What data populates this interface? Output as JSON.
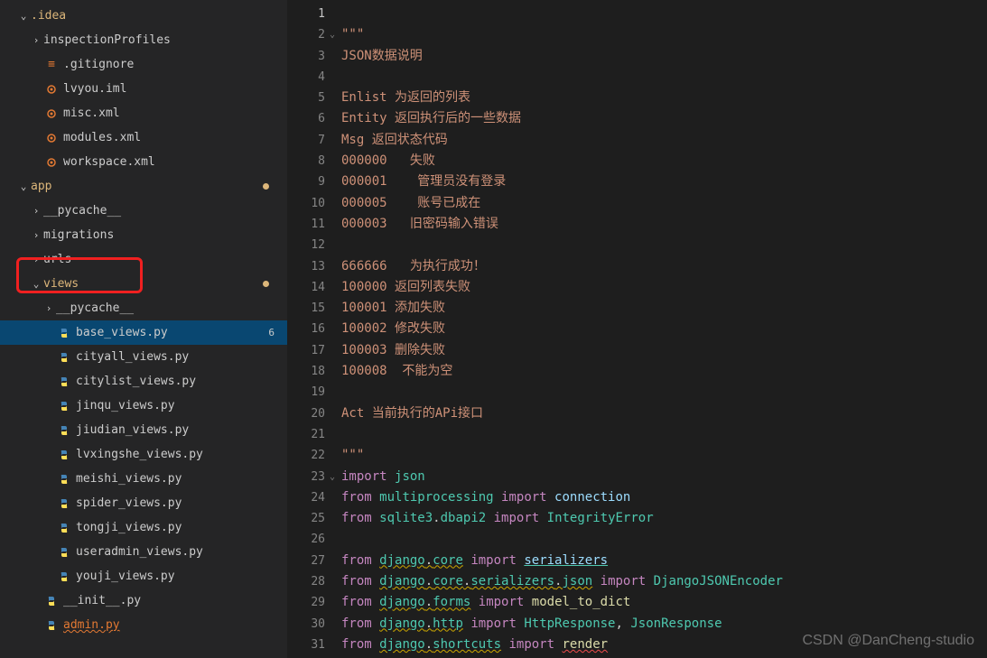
{
  "sidebar": {
    "items": [
      {
        "depth": 0,
        "chev": "v",
        "icon": "",
        "label": ".idea",
        "cls": "orange",
        "dot": false
      },
      {
        "depth": 1,
        "chev": ">",
        "icon": "",
        "label": "inspectionProfiles",
        "cls": "white",
        "dot": false
      },
      {
        "depth": 1,
        "chev": "",
        "icon": "git",
        "label": ".gitignore",
        "cls": "white",
        "dot": false
      },
      {
        "depth": 1,
        "chev": "",
        "icon": "iml",
        "label": "lvyou.iml",
        "cls": "white",
        "dot": false
      },
      {
        "depth": 1,
        "chev": "",
        "icon": "xml",
        "label": "misc.xml",
        "cls": "white",
        "dot": false
      },
      {
        "depth": 1,
        "chev": "",
        "icon": "xml",
        "label": "modules.xml",
        "cls": "white",
        "dot": false
      },
      {
        "depth": 1,
        "chev": "",
        "icon": "xml",
        "label": "workspace.xml",
        "cls": "white",
        "dot": false
      },
      {
        "depth": 0,
        "chev": "v",
        "icon": "",
        "label": "app",
        "cls": "orange",
        "dot": true
      },
      {
        "depth": 1,
        "chev": ">",
        "icon": "",
        "label": "__pycache__",
        "cls": "white",
        "dot": false
      },
      {
        "depth": 1,
        "chev": ">",
        "icon": "",
        "label": "migrations",
        "cls": "white",
        "dot": false
      },
      {
        "depth": 1,
        "chev": ">",
        "icon": "",
        "label": "urls",
        "cls": "white",
        "dot": false
      },
      {
        "depth": 1,
        "chev": "v",
        "icon": "",
        "label": "views",
        "cls": "orange",
        "dot": true,
        "hl": true
      },
      {
        "depth": 2,
        "chev": ">",
        "icon": "",
        "label": "__pycache__",
        "cls": "white",
        "dot": false
      },
      {
        "depth": 2,
        "chev": "",
        "icon": "py",
        "label": "base_views.py",
        "cls": "white",
        "active": true,
        "badge": "6"
      },
      {
        "depth": 2,
        "chev": "",
        "icon": "py",
        "label": "cityall_views.py",
        "cls": "white",
        "dot": false
      },
      {
        "depth": 2,
        "chev": "",
        "icon": "py",
        "label": "citylist_views.py",
        "cls": "white",
        "dot": false
      },
      {
        "depth": 2,
        "chev": "",
        "icon": "py",
        "label": "jinqu_views.py",
        "cls": "white",
        "dot": false
      },
      {
        "depth": 2,
        "chev": "",
        "icon": "py",
        "label": "jiudian_views.py",
        "cls": "white",
        "dot": false
      },
      {
        "depth": 2,
        "chev": "",
        "icon": "py",
        "label": "lvxingshe_views.py",
        "cls": "white",
        "dot": false
      },
      {
        "depth": 2,
        "chev": "",
        "icon": "py",
        "label": "meishi_views.py",
        "cls": "white",
        "dot": false
      },
      {
        "depth": 2,
        "chev": "",
        "icon": "py",
        "label": "spider_views.py",
        "cls": "white",
        "dot": false
      },
      {
        "depth": 2,
        "chev": "",
        "icon": "py",
        "label": "tongji_views.py",
        "cls": "white",
        "dot": false
      },
      {
        "depth": 2,
        "chev": "",
        "icon": "py",
        "label": "useradmin_views.py",
        "cls": "white",
        "dot": false
      },
      {
        "depth": 2,
        "chev": "",
        "icon": "py",
        "label": "youji_views.py",
        "cls": "white",
        "dot": false
      },
      {
        "depth": 1,
        "chev": "",
        "icon": "py",
        "label": "__init__.py",
        "cls": "white",
        "dot": false
      },
      {
        "depth": 1,
        "chev": "",
        "icon": "py",
        "label": "admin.py",
        "cls": "error",
        "dot": false
      }
    ]
  },
  "editor": {
    "lines": [
      {
        "n": 1,
        "frag": [
          {
            "t": "",
            "c": ""
          }
        ]
      },
      {
        "n": 2,
        "fold": "v",
        "frag": [
          {
            "t": "\"\"\"",
            "c": "tok-string"
          }
        ]
      },
      {
        "n": 3,
        "frag": [
          {
            "t": "JSON数据说明",
            "c": "tok-string"
          }
        ]
      },
      {
        "n": 4,
        "frag": [
          {
            "t": "",
            "c": ""
          }
        ]
      },
      {
        "n": 5,
        "frag": [
          {
            "t": "Enlist 为返回的列表",
            "c": "tok-string"
          }
        ]
      },
      {
        "n": 6,
        "frag": [
          {
            "t": "Entity 返回执行后的一些数据",
            "c": "tok-string"
          }
        ]
      },
      {
        "n": 7,
        "frag": [
          {
            "t": "Msg 返回状态代码",
            "c": "tok-string"
          }
        ]
      },
      {
        "n": 8,
        "frag": [
          {
            "t": "000000   失败",
            "c": "tok-string"
          }
        ]
      },
      {
        "n": 9,
        "frag": [
          {
            "t": "000001    管理员没有登录",
            "c": "tok-string"
          }
        ]
      },
      {
        "n": 10,
        "frag": [
          {
            "t": "000005    账号已成在",
            "c": "tok-string"
          }
        ]
      },
      {
        "n": 11,
        "frag": [
          {
            "t": "000003   旧密码输入错误",
            "c": "tok-string"
          }
        ]
      },
      {
        "n": 12,
        "frag": [
          {
            "t": "",
            "c": ""
          }
        ]
      },
      {
        "n": 13,
        "frag": [
          {
            "t": "666666   为执行成功！",
            "c": "tok-string"
          }
        ]
      },
      {
        "n": 14,
        "frag": [
          {
            "t": "100000 返回列表失败",
            "c": "tok-string"
          }
        ]
      },
      {
        "n": 15,
        "frag": [
          {
            "t": "100001 添加失败",
            "c": "tok-string"
          }
        ]
      },
      {
        "n": 16,
        "frag": [
          {
            "t": "100002 修改失败",
            "c": "tok-string"
          }
        ]
      },
      {
        "n": 17,
        "frag": [
          {
            "t": "100003 删除失败",
            "c": "tok-string"
          }
        ]
      },
      {
        "n": 18,
        "frag": [
          {
            "t": "100008  不能为空",
            "c": "tok-string"
          }
        ]
      },
      {
        "n": 19,
        "frag": [
          {
            "t": "",
            "c": ""
          }
        ]
      },
      {
        "n": 20,
        "frag": [
          {
            "t": "Act 当前执行的APi接口",
            "c": "tok-string"
          }
        ]
      },
      {
        "n": 21,
        "frag": [
          {
            "t": "",
            "c": ""
          }
        ]
      },
      {
        "n": 22,
        "frag": [
          {
            "t": "\"\"\"",
            "c": "tok-string"
          }
        ]
      },
      {
        "n": 23,
        "fold": "v",
        "frag": [
          {
            "t": "import",
            "c": "tok-keyword"
          },
          {
            "t": " ",
            "c": ""
          },
          {
            "t": "json",
            "c": "tok-module"
          }
        ]
      },
      {
        "n": 24,
        "frag": [
          {
            "t": "from",
            "c": "tok-keyword"
          },
          {
            "t": " ",
            "c": ""
          },
          {
            "t": "multiprocessing",
            "c": "tok-module"
          },
          {
            "t": " ",
            "c": ""
          },
          {
            "t": "import",
            "c": "tok-keyword"
          },
          {
            "t": " ",
            "c": ""
          },
          {
            "t": "connection",
            "c": "tok-var"
          }
        ]
      },
      {
        "n": 25,
        "frag": [
          {
            "t": "from",
            "c": "tok-keyword"
          },
          {
            "t": " ",
            "c": ""
          },
          {
            "t": "sqlite3",
            "c": "tok-module"
          },
          {
            "t": ".",
            "c": ""
          },
          {
            "t": "dbapi2",
            "c": "tok-module"
          },
          {
            "t": " ",
            "c": ""
          },
          {
            "t": "import",
            "c": "tok-keyword"
          },
          {
            "t": " ",
            "c": ""
          },
          {
            "t": "IntegrityError",
            "c": "tok-module"
          }
        ]
      },
      {
        "n": 26,
        "frag": [
          {
            "t": "",
            "c": ""
          }
        ]
      },
      {
        "n": 27,
        "frag": [
          {
            "t": "from",
            "c": "tok-keyword"
          },
          {
            "t": " ",
            "c": ""
          },
          {
            "t": "django",
            "c": "tok-module tok-wavy"
          },
          {
            "t": ".",
            "c": "tok-wavy"
          },
          {
            "t": "core",
            "c": "tok-module tok-wavy"
          },
          {
            "t": " ",
            "c": ""
          },
          {
            "t": "import",
            "c": "tok-keyword"
          },
          {
            "t": " ",
            "c": ""
          },
          {
            "t": "serializers",
            "c": "tok-var tok-underline"
          }
        ]
      },
      {
        "n": 28,
        "frag": [
          {
            "t": "from",
            "c": "tok-keyword"
          },
          {
            "t": " ",
            "c": ""
          },
          {
            "t": "django",
            "c": "tok-module tok-wavy"
          },
          {
            "t": ".",
            "c": "tok-wavy"
          },
          {
            "t": "core",
            "c": "tok-module tok-wavy"
          },
          {
            "t": ".",
            "c": "tok-wavy"
          },
          {
            "t": "serializers",
            "c": "tok-module tok-wavy"
          },
          {
            "t": ".",
            "c": "tok-wavy"
          },
          {
            "t": "json",
            "c": "tok-module tok-wavy"
          },
          {
            "t": " ",
            "c": ""
          },
          {
            "t": "import",
            "c": "tok-keyword"
          },
          {
            "t": " ",
            "c": ""
          },
          {
            "t": "DjangoJSONEncoder",
            "c": "tok-module"
          }
        ]
      },
      {
        "n": 29,
        "frag": [
          {
            "t": "from",
            "c": "tok-keyword"
          },
          {
            "t": " ",
            "c": ""
          },
          {
            "t": "django",
            "c": "tok-module tok-wavy"
          },
          {
            "t": ".",
            "c": "tok-wavy"
          },
          {
            "t": "forms",
            "c": "tok-module tok-wavy"
          },
          {
            "t": " ",
            "c": ""
          },
          {
            "t": "import",
            "c": "tok-keyword"
          },
          {
            "t": " ",
            "c": ""
          },
          {
            "t": "model_to_dict",
            "c": "tok-func"
          }
        ]
      },
      {
        "n": 30,
        "frag": [
          {
            "t": "from",
            "c": "tok-keyword"
          },
          {
            "t": " ",
            "c": ""
          },
          {
            "t": "django",
            "c": "tok-module tok-wavy"
          },
          {
            "t": ".",
            "c": "tok-wavy"
          },
          {
            "t": "http",
            "c": "tok-module tok-wavy"
          },
          {
            "t": " ",
            "c": ""
          },
          {
            "t": "import",
            "c": "tok-keyword"
          },
          {
            "t": " ",
            "c": ""
          },
          {
            "t": "HttpResponse",
            "c": "tok-module"
          },
          {
            "t": ", ",
            "c": ""
          },
          {
            "t": "JsonResponse",
            "c": "tok-module"
          }
        ]
      },
      {
        "n": 31,
        "frag": [
          {
            "t": "from",
            "c": "tok-keyword"
          },
          {
            "t": " ",
            "c": ""
          },
          {
            "t": "django",
            "c": "tok-module tok-wavy"
          },
          {
            "t": ".",
            "c": "tok-wavy"
          },
          {
            "t": "shortcuts",
            "c": "tok-module tok-wavy"
          },
          {
            "t": " ",
            "c": ""
          },
          {
            "t": "import",
            "c": "tok-keyword"
          },
          {
            "t": " ",
            "c": ""
          },
          {
            "t": "render",
            "c": "tok-func tok-err"
          }
        ]
      }
    ]
  },
  "watermark": "CSDN @DanCheng-studio"
}
